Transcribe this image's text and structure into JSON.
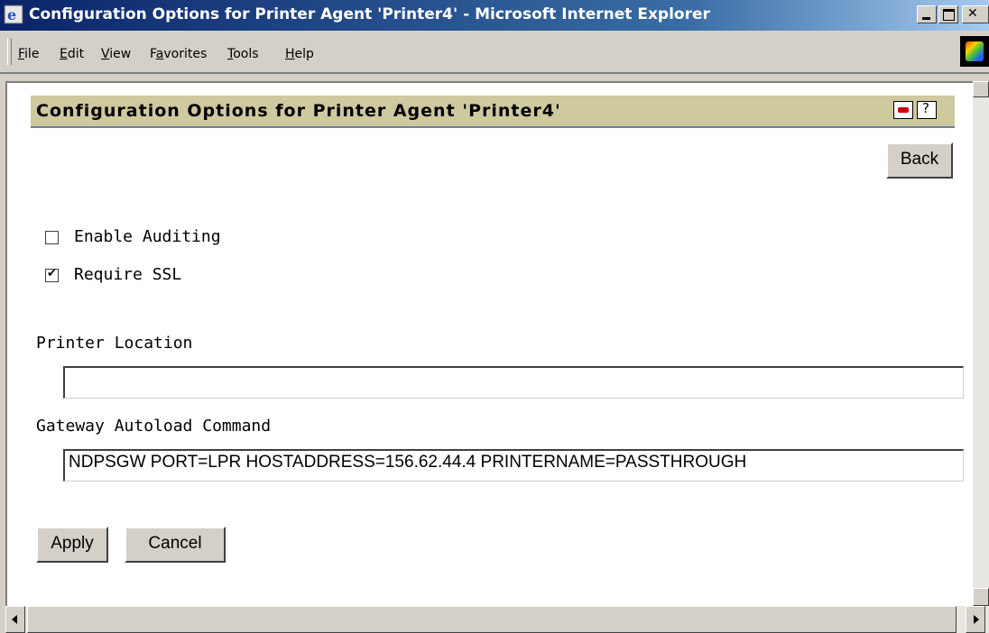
{
  "window": {
    "title": "Configuration Options for Printer Agent 'Printer4' - Microsoft Internet Explorer"
  },
  "menu": {
    "items": [
      {
        "label": "File",
        "accel": "F"
      },
      {
        "label": "Edit",
        "accel": "E"
      },
      {
        "label": "View",
        "accel": "V"
      },
      {
        "label": "Favorites",
        "accel": "a"
      },
      {
        "label": "Tools",
        "accel": "T"
      },
      {
        "label": "Help",
        "accel": "H"
      }
    ]
  },
  "page": {
    "title": "Configuration Options for Printer Agent 'Printer4'",
    "back_label": "Back",
    "enable_auditing": {
      "label": "Enable Auditing",
      "checked": false
    },
    "require_ssl": {
      "label": "Require SSL",
      "checked": true
    },
    "printer_location": {
      "label": "Printer Location",
      "value": ""
    },
    "gateway_autoload": {
      "label": "Gateway Autoload Command",
      "value": "NDPSGW PORT=LPR HOSTADDRESS=156.62.44.4  PRINTERNAME=PASSTHROUGH"
    },
    "apply_label": "Apply",
    "cancel_label": "Cancel"
  },
  "icons": {
    "browser": "ie-logo-icon",
    "print": "print-icon",
    "help": "help-icon"
  }
}
